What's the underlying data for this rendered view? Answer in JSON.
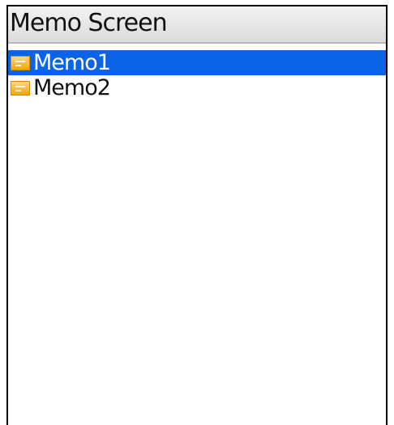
{
  "window": {
    "title": "Memo Screen"
  },
  "memos": {
    "items": [
      {
        "label": "Memo1",
        "icon": "memo-icon",
        "selected": true
      },
      {
        "label": "Memo2",
        "icon": "memo-icon",
        "selected": false
      }
    ]
  },
  "colors": {
    "selection": "#0b63e6",
    "icon": "#f2a600"
  }
}
